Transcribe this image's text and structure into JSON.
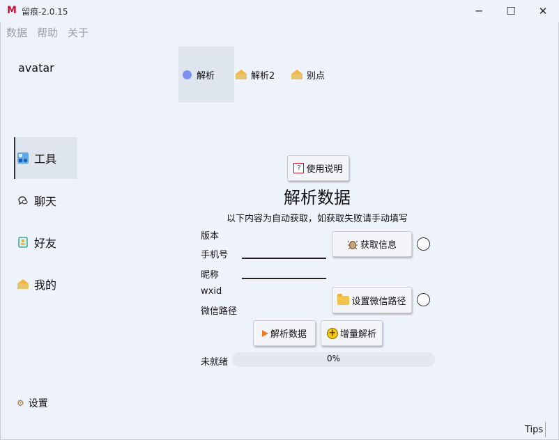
{
  "titlebar": {
    "logo": "M",
    "title": "留痕-2.0.15",
    "min": "─",
    "max": "☐",
    "close": "✕"
  },
  "menu": [
    "数据",
    "帮助",
    "关于"
  ],
  "sidebar": {
    "avatar": "avatar",
    "items": [
      {
        "label": "工具",
        "icon": "tools-icon"
      },
      {
        "label": "聊天",
        "icon": "chat-icon"
      },
      {
        "label": "好友",
        "icon": "contacts-icon"
      },
      {
        "label": "我的",
        "icon": "house-icon"
      }
    ],
    "settings": "设置"
  },
  "tabs": [
    {
      "label": "解析",
      "icon": "blue-circle-icon"
    },
    {
      "label": "解析2",
      "icon": "house-icon"
    },
    {
      "label": "别点",
      "icon": "house-icon"
    }
  ],
  "main": {
    "help_button": "使用说明",
    "heading": "解析数据",
    "subheading": "以下内容为自动获取，如获取失败请手动填写",
    "labels": {
      "version": "版本",
      "phone": "手机号",
      "nickname": "昵称",
      "wxid": "wxid",
      "wechat_path": "微信路径"
    },
    "inputs": {
      "phone": "",
      "nickname": ""
    },
    "get_info_button": "获取信息",
    "set_path_button": "设置微信路径",
    "parse_button": "解析数据",
    "incremental_button": "增量解析",
    "status": "未就绪",
    "progress_text": "0%",
    "progress_value": 0
  },
  "footer": {
    "tips": "Tips"
  }
}
